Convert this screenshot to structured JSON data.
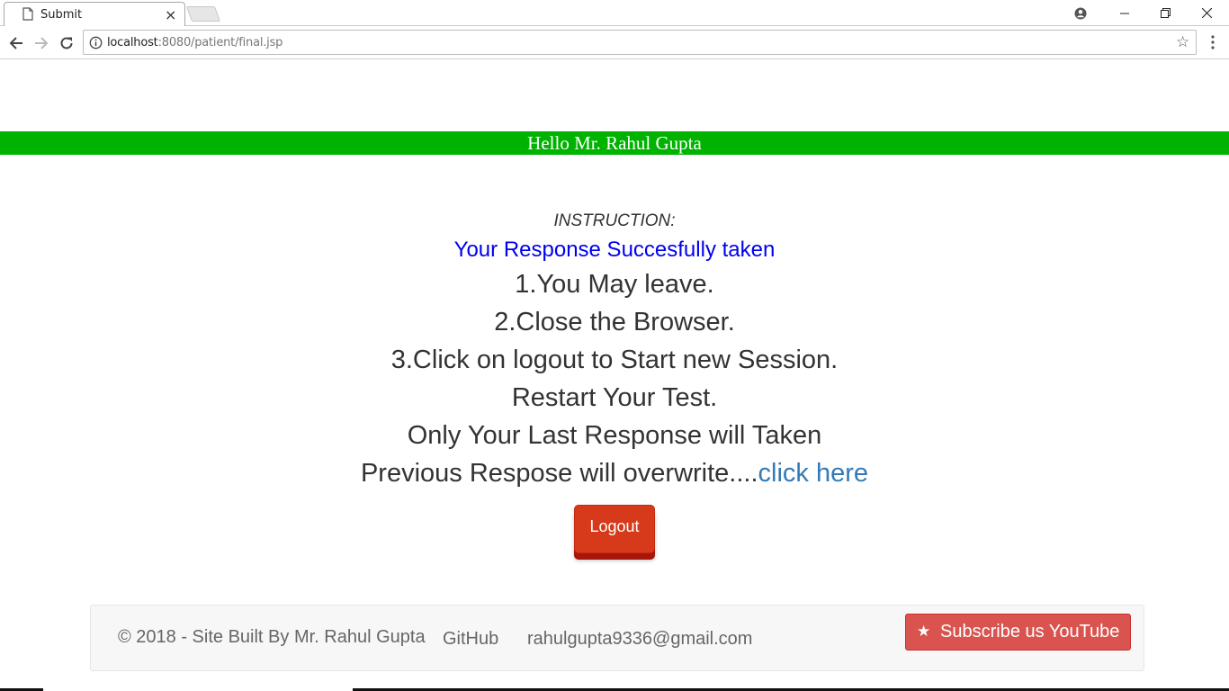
{
  "browser": {
    "tab_title": "Submit",
    "tab_close": "×",
    "url_host": "localhost",
    "url_path": ":8080/patient/final.jsp",
    "bookmark_star": "☆"
  },
  "page": {
    "banner": "Hello Mr. Rahul Gupta",
    "instruction_heading": "INSTRUCTION:",
    "success_message": "Your Response Succesfully taken",
    "lines": [
      "1.You May leave.",
      "2.Close the Browser.",
      "3.Click on logout to Start new Session.",
      "Restart Your Test.",
      "Only Your Last Response will Taken"
    ],
    "overwrite_text": "Previous Respose will overwrite....",
    "click_here_link": "click here",
    "logout_button": "Logout"
  },
  "footer": {
    "copyright": "© 2018 - Site Built By Mr. Rahul Gupta",
    "github_link": "GitHub",
    "email_link": "rahulgupta9336@gmail.com",
    "subscribe_icon": "★",
    "subscribe_label": "Subscribe us YouTube"
  },
  "colors": {
    "banner_bg": "#00b300",
    "success_text": "#0000ee",
    "link": "#337ab7",
    "logout_bg": "#d63a1a",
    "subscribe_bg": "#d9534f"
  }
}
